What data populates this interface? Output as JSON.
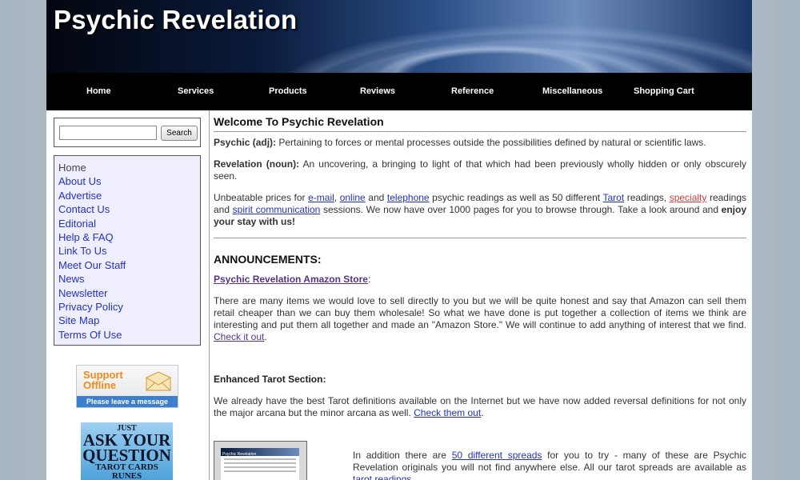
{
  "site": {
    "title": "Psychic Revelation"
  },
  "nav": [
    {
      "label": "Home"
    },
    {
      "label": "Services"
    },
    {
      "label": "Products"
    },
    {
      "label": "Reviews"
    },
    {
      "label": "Reference"
    },
    {
      "label": "Miscellaneous"
    },
    {
      "label": "Shopping Cart"
    }
  ],
  "search": {
    "placeholder": "",
    "value": "",
    "button_label": "Search"
  },
  "sidebar": {
    "items": [
      {
        "label": "Home"
      },
      {
        "label": "About Us"
      },
      {
        "label": "Advertise"
      },
      {
        "label": "Contact Us"
      },
      {
        "label": "Editorial"
      },
      {
        "label": "Help & FAQ"
      },
      {
        "label": "Link To Us"
      },
      {
        "label": "Meet Our Staff"
      },
      {
        "label": "News"
      },
      {
        "label": "Newsletter"
      },
      {
        "label": "Privacy Policy"
      },
      {
        "label": "Site Map"
      },
      {
        "label": "Terms Of Use"
      }
    ],
    "support": {
      "line1": "Support",
      "line2": "Offline",
      "strip": "Please leave a message"
    },
    "ask_ad": {
      "line1": "JUST",
      "line2": "ASK YOUR",
      "line3": "QUESTION",
      "line4": "TAROT CARDS",
      "line5": "RUNES"
    }
  },
  "main": {
    "title": "Welcome To Psychic Revelation",
    "def1": {
      "term": "Psychic (adj):",
      "text": " Pertaining to forces or mental processes outside the possibilities defined by natural or scientific laws."
    },
    "def2": {
      "term": "Revelation (noun):",
      "text": " An uncovering, a bringing to light of that which had been previously wholly hidden or only obscurely seen."
    },
    "intro": {
      "t1": "Unbeatable prices for ",
      "l1": "e-mail",
      "t2": ", ",
      "l2": "online",
      "t3": " and ",
      "l3": "telephone",
      "t4": " psychic readings as well as 50 different ",
      "l4": "Tarot",
      "t5": " readings, ",
      "l5": "specialty",
      "t6": " readings and ",
      "l6": "spirit communication",
      "t7": " sessions. We now have over 1000 pages for you to browse through. Take a look around and ",
      "bold": "enjoy your stay with us!"
    },
    "announcements_title": "ANNOUNCEMENTS:",
    "amazon": {
      "link": "Psychic Revelation Amazon Store",
      "colon": ":",
      "text": "There are many items we would love to sell directly to you but we will be quite honest and say that Amazon can sell them retail cheaper than we can buy them wholesale! So what we have done is put together a collection of items we think are interesting and put them all together and made an \"Amazon Store.\" We will continue to add anything of interest that we find. ",
      "cta": "Check it out",
      "end": "."
    },
    "tarot": {
      "heading": "Enhanced Tarot Section:",
      "text": "We already have the best Tarot definitions available on the Internet but we have now added reversal definitions for not only the major arcana but the minor arcana as well. ",
      "cta": "Check them out",
      "end": "."
    },
    "thumb": {
      "label": "Psychic Revelation"
    },
    "spreads": {
      "t1": "In addition there are ",
      "link": "50 different spreads",
      "t2": " for you to try - many of these are Psychic Revelation originals you will not find anywhere else. All our tarot spreads are available as ",
      "link2": "tarot readings",
      "t3": "."
    }
  }
}
